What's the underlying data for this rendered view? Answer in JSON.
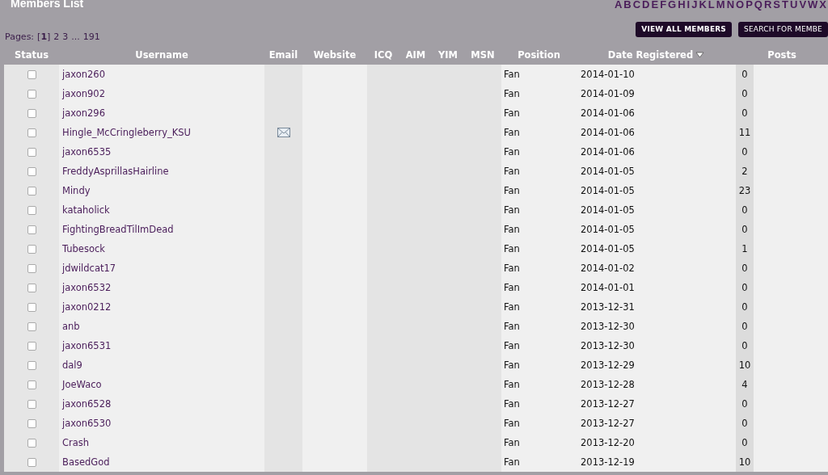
{
  "title": "Members List",
  "letters": [
    "A",
    "B",
    "C",
    "D",
    "E",
    "F",
    "G",
    "H",
    "I",
    "J",
    "K",
    "L",
    "M",
    "N",
    "O",
    "P",
    "Q",
    "R",
    "S",
    "T",
    "U",
    "V",
    "W",
    "X"
  ],
  "pages": {
    "label": "Pages:",
    "current": "[**1**]",
    "links": [
      "2",
      "3"
    ],
    "ellipsis": "...",
    "last": "191"
  },
  "buttons": [
    "VIEW ALL MEMBERS",
    "SEARCH FOR MEMBE"
  ],
  "columns": [
    {
      "label": "Status",
      "sorted": false
    },
    {
      "label": "Username",
      "sorted": false
    },
    {
      "label": "Email",
      "sorted": false
    },
    {
      "label": "Website",
      "sorted": false
    },
    {
      "label": "ICQ",
      "sorted": false
    },
    {
      "label": "AIM",
      "sorted": false
    },
    {
      "label": "YIM",
      "sorted": false
    },
    {
      "label": "MSN",
      "sorted": false
    },
    {
      "label": "Position",
      "sorted": false
    },
    {
      "label": "Date Registered",
      "sorted": true
    },
    {
      "label": "Posts",
      "sorted": false
    }
  ],
  "rows": [
    {
      "checked": false,
      "username": "jaxon260",
      "has_email": false,
      "position": "Fan",
      "date": "2014-01-10",
      "posts": "0"
    },
    {
      "checked": false,
      "username": "jaxon902",
      "has_email": false,
      "position": "Fan",
      "date": "2014-01-09",
      "posts": "0"
    },
    {
      "checked": false,
      "username": "jaxon296",
      "has_email": false,
      "position": "Fan",
      "date": "2014-01-06",
      "posts": "0"
    },
    {
      "checked": false,
      "username": "Hingle_McCringleberry_KSU",
      "has_email": true,
      "position": "Fan",
      "date": "2014-01-06",
      "posts": "11"
    },
    {
      "checked": false,
      "username": "jaxon6535",
      "has_email": false,
      "position": "Fan",
      "date": "2014-01-06",
      "posts": "0"
    },
    {
      "checked": false,
      "username": "FreddyAsprillasHairline",
      "has_email": false,
      "position": "Fan",
      "date": "2014-01-05",
      "posts": "2"
    },
    {
      "checked": false,
      "username": "Mindy",
      "has_email": false,
      "position": "Fan",
      "date": "2014-01-05",
      "posts": "23"
    },
    {
      "checked": false,
      "username": "kataholick",
      "has_email": false,
      "position": "Fan",
      "date": "2014-01-05",
      "posts": "0"
    },
    {
      "checked": false,
      "username": "FightingBreadTilImDead",
      "has_email": false,
      "position": "Fan",
      "date": "2014-01-05",
      "posts": "0"
    },
    {
      "checked": false,
      "username": "Tubesock",
      "has_email": false,
      "position": "Fan",
      "date": "2014-01-05",
      "posts": "1"
    },
    {
      "checked": false,
      "username": "jdwildcat17",
      "has_email": false,
      "position": "Fan",
      "date": "2014-01-02",
      "posts": "0"
    },
    {
      "checked": false,
      "username": "jaxon6532",
      "has_email": false,
      "position": "Fan",
      "date": "2014-01-01",
      "posts": "0"
    },
    {
      "checked": false,
      "username": "jaxon0212",
      "has_email": false,
      "position": "Fan",
      "date": "2013-12-31",
      "posts": "0"
    },
    {
      "checked": false,
      "username": "anb",
      "has_email": false,
      "position": "Fan",
      "date": "2013-12-30",
      "posts": "0"
    },
    {
      "checked": false,
      "username": "jaxon6531",
      "has_email": false,
      "position": "Fan",
      "date": "2013-12-30",
      "posts": "0"
    },
    {
      "checked": false,
      "username": "dal9",
      "has_email": false,
      "position": "Fan",
      "date": "2013-12-29",
      "posts": "10"
    },
    {
      "checked": false,
      "username": "JoeWaco",
      "has_email": false,
      "position": "Fan",
      "date": "2013-12-28",
      "posts": "4"
    },
    {
      "checked": false,
      "username": "jaxon6528",
      "has_email": false,
      "position": "Fan",
      "date": "2013-12-27",
      "posts": "0"
    },
    {
      "checked": false,
      "username": "jaxon6530",
      "has_email": false,
      "position": "Fan",
      "date": "2013-12-27",
      "posts": "0"
    },
    {
      "checked": false,
      "username": "Crash",
      "has_email": false,
      "position": "Fan",
      "date": "2013-12-20",
      "posts": "0"
    },
    {
      "checked": false,
      "username": "BasedGod",
      "has_email": false,
      "position": "Fan",
      "date": "2013-12-19",
      "posts": "10"
    }
  ]
}
